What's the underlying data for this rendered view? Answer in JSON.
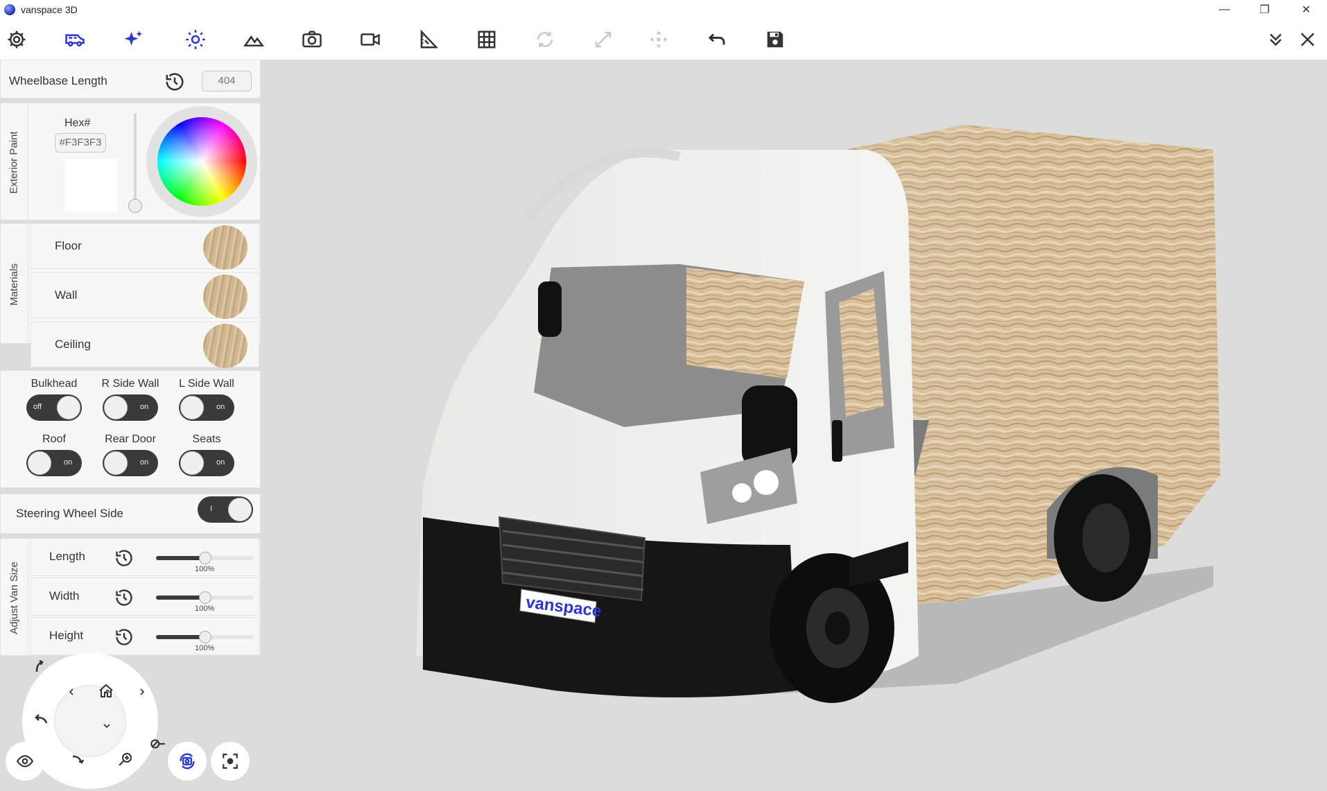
{
  "window": {
    "title": "vanspace 3D",
    "controls": {
      "minimize": "—",
      "restore": "❐",
      "close": "✕"
    }
  },
  "toolbar": {
    "icons": [
      "gear-icon",
      "van-icon",
      "sparkle-icon",
      "sun-icon",
      "terrain-icon",
      "camera-icon",
      "video-icon",
      "measure-icon",
      "grid-icon",
      "rotate-icon",
      "resize-icon",
      "move-icon",
      "undo-icon",
      "save-icon"
    ],
    "right_icons": [
      "chevron-double-down-icon",
      "close-icon"
    ],
    "active_color": "#2a35d4",
    "disabled_color": "#c9c9c9"
  },
  "wheelbase": {
    "label": "Wheelbase Length",
    "value": "404"
  },
  "exterior_paint": {
    "section_label": "Exterior Paint",
    "hex_label": "Hex#",
    "hex_value": "#F3F3F3",
    "color": "#F3F3F3"
  },
  "materials": {
    "section_label": "Materials",
    "items": [
      {
        "label": "Floor"
      },
      {
        "label": "Wall"
      },
      {
        "label": "Ceiling"
      }
    ]
  },
  "toggles": [
    {
      "label": "Bulkhead",
      "state": "off"
    },
    {
      "label": "R Side Wall",
      "state": "on"
    },
    {
      "label": "L Side Wall",
      "state": "on"
    },
    {
      "label": "Roof",
      "state": "on"
    },
    {
      "label": "Rear Door",
      "state": "on"
    },
    {
      "label": "Seats",
      "state": "on"
    }
  ],
  "steering": {
    "label": "Steering Wheel Side",
    "state": "I"
  },
  "van_size": {
    "section_label": "Adjust Van Size",
    "rows": [
      {
        "label": "Length",
        "value": "100%"
      },
      {
        "label": "Width",
        "value": "100%"
      },
      {
        "label": "Height",
        "value": "100%"
      }
    ]
  },
  "viewport": {
    "plate_text": "vanspace"
  }
}
